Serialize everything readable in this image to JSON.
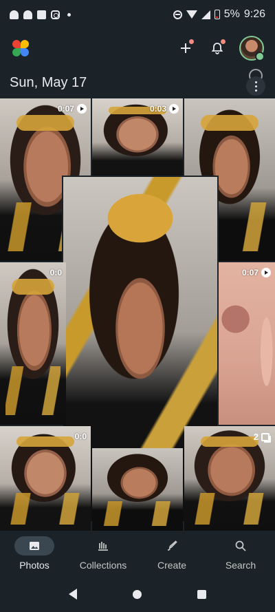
{
  "status_bar": {
    "battery": "5%",
    "time": "9:26",
    "left_icons": [
      "snapchat-icon",
      "snapchat-icon",
      "news-icon",
      "instagram-icon",
      "dot-icon"
    ],
    "right_icons": [
      "do-not-disturb-icon",
      "wifi-icon",
      "signal-icon",
      "battery-icon"
    ]
  },
  "header": {
    "logo": "google-photos-logo",
    "actions": [
      "add-icon",
      "notifications-icon",
      "account-avatar"
    ]
  },
  "date_header": "Sun, May 17",
  "grid": {
    "tiles": [
      {
        "duration": "0:07",
        "type": "video"
      },
      {
        "duration": "0:03",
        "type": "video"
      },
      {
        "duration": "",
        "type": "photo"
      },
      {
        "duration": "",
        "type": "photo"
      },
      {
        "duration": "",
        "type": "photo"
      },
      {
        "duration": "0:0",
        "type": "video"
      },
      {
        "duration": "0:07",
        "type": "video"
      },
      {
        "duration": "",
        "type": "photo"
      },
      {
        "duration": "0:0",
        "type": "video"
      },
      {
        "duration": "",
        "type": "photo"
      },
      {
        "count": "2",
        "type": "stack"
      }
    ]
  },
  "bottom_nav": {
    "items": [
      {
        "label": "Photos",
        "icon": "photos-icon",
        "active": true
      },
      {
        "label": "Collections",
        "icon": "collections-icon",
        "active": false
      },
      {
        "label": "Create",
        "icon": "create-icon",
        "active": false
      },
      {
        "label": "Search",
        "icon": "search-icon",
        "active": false
      }
    ]
  },
  "colors": {
    "background": "#1b2228",
    "active_pill": "#3a4650",
    "accent_green": "#81c995",
    "notification_dot": "#f28b82"
  }
}
